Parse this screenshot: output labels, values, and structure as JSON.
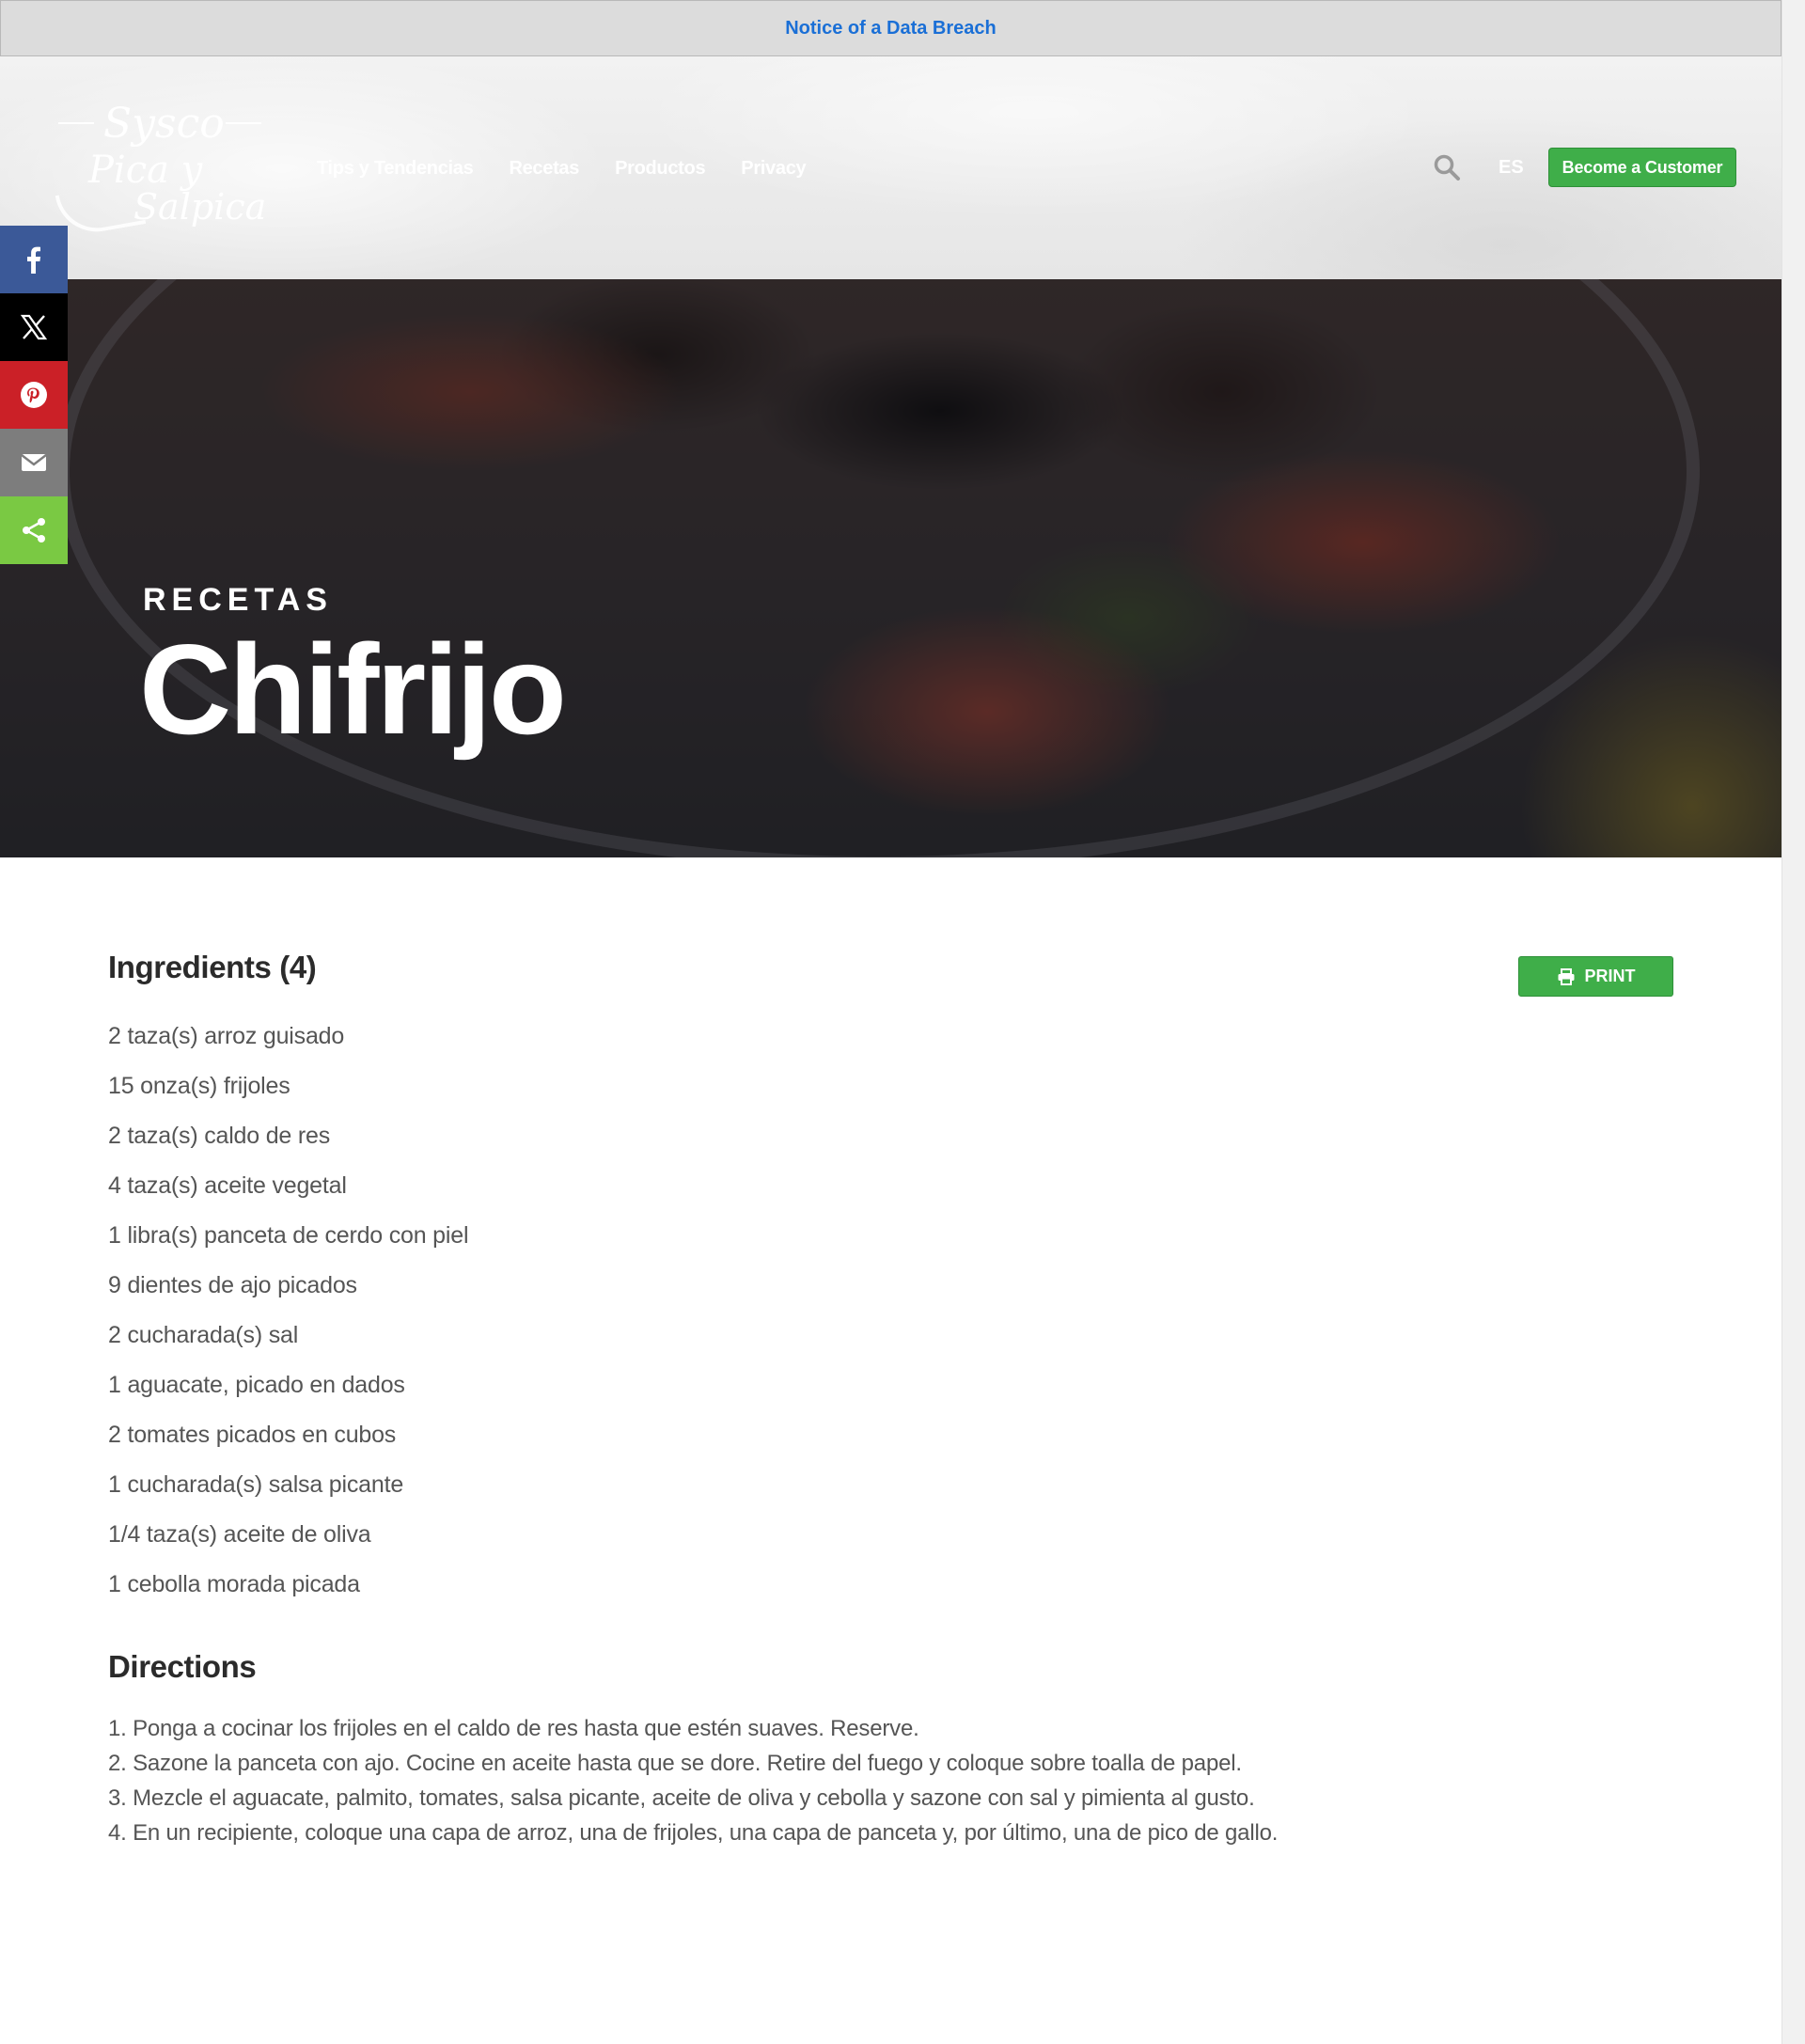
{
  "notice": {
    "text": "Notice of a Data Breach"
  },
  "header": {
    "logo": {
      "line1": "Sysco",
      "line2": "Pica y",
      "line3": "Salpica"
    },
    "nav": [
      {
        "label": "Tips y Tendencias"
      },
      {
        "label": "Recetas"
      },
      {
        "label": "Productos"
      },
      {
        "label": "Privacy"
      }
    ],
    "language": "ES",
    "cta_label": "Become a Customer"
  },
  "share": {
    "icons": [
      "facebook-icon",
      "x-icon",
      "pinterest-icon",
      "email-icon",
      "share-icon"
    ]
  },
  "hero": {
    "kicker": "RECETAS",
    "title": "Chifrijo"
  },
  "ingredients": {
    "title": "Ingredients (4)",
    "print_label": "PRINT",
    "items": [
      "2 taza(s) arroz guisado",
      "15 onza(s) frijoles",
      "2 taza(s) caldo de res",
      "4 taza(s) aceite vegetal",
      "1 libra(s) panceta de cerdo con piel",
      "9 dientes de ajo picados",
      "2 cucharada(s) sal",
      "1 aguacate, picado en dados",
      "2 tomates picados en cubos",
      "1 cucharada(s) salsa picante",
      "1/4 taza(s) aceite de oliva",
      "1 cebolla morada picada"
    ]
  },
  "directions": {
    "title": "Directions",
    "steps": [
      "1. Ponga a cocinar los frijoles en el caldo de res hasta que estén suaves. Reserve.",
      "2. Sazone la panceta con ajo. Cocine en aceite hasta que se dore. Retire del fuego y coloque sobre toalla de papel.",
      "3. Mezcle el aguacate, palmito, tomates, salsa picante, aceite de oliva y cebolla y sazone con sal y pimienta al gusto.",
      "4. En un recipiente, coloque una capa de arroz, una de frijoles, una capa de panceta y, por último, una de pico de gallo."
    ]
  },
  "colors": {
    "accent_green": "#3fae49",
    "link_blue": "#1a6fd6",
    "facebook": "#3b5998",
    "x": "#000000",
    "pinterest": "#cb2027",
    "email": "#7d7d7d",
    "share": "#7ac943"
  }
}
